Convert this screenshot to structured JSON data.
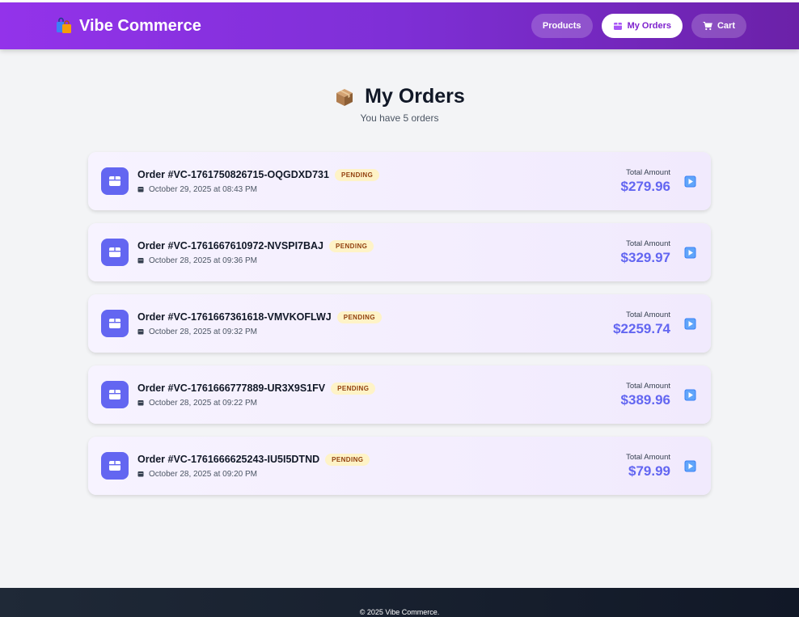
{
  "header": {
    "brand": "Vibe Commerce",
    "nav": {
      "products": "Products",
      "orders": "My Orders",
      "cart": "Cart"
    }
  },
  "page": {
    "title": "My Orders",
    "subtitle": "You have 5 orders"
  },
  "orders": [
    {
      "id": "Order #VC-1761750826715-OQGDXD731",
      "status": "PENDING",
      "date": "October 29, 2025 at 08:43 PM",
      "amount_label": "Total Amount",
      "amount": "$279.96"
    },
    {
      "id": "Order #VC-1761667610972-NVSPI7BAJ",
      "status": "PENDING",
      "date": "October 28, 2025 at 09:36 PM",
      "amount_label": "Total Amount",
      "amount": "$329.97"
    },
    {
      "id": "Order #VC-1761667361618-VMVKOFLWJ",
      "status": "PENDING",
      "date": "October 28, 2025 at 09:32 PM",
      "amount_label": "Total Amount",
      "amount": "$2259.74"
    },
    {
      "id": "Order #VC-1761666777889-UR3X9S1FV",
      "status": "PENDING",
      "date": "October 28, 2025 at 09:22 PM",
      "amount_label": "Total Amount",
      "amount": "$389.96"
    },
    {
      "id": "Order #VC-1761666625243-IU5I5DTND",
      "status": "PENDING",
      "date": "October 28, 2025 at 09:20 PM",
      "amount_label": "Total Amount",
      "amount": "$79.99"
    }
  ],
  "footer": {
    "text": "© 2025 Vibe Commerce."
  },
  "colors": {
    "header_gradient_start": "#9333ea",
    "header_gradient_end": "#6b21a8",
    "accent": "#6366f1",
    "status_pending_bg": "#fef3c7",
    "status_pending_text": "#92400e"
  },
  "icons": {
    "brand": "shopping-bags-icon",
    "orders_nav": "package-icon",
    "cart_nav": "cart-icon",
    "title": "box-icon",
    "order": "box-icon",
    "date": "calendar-icon",
    "expand": "play-icon"
  }
}
